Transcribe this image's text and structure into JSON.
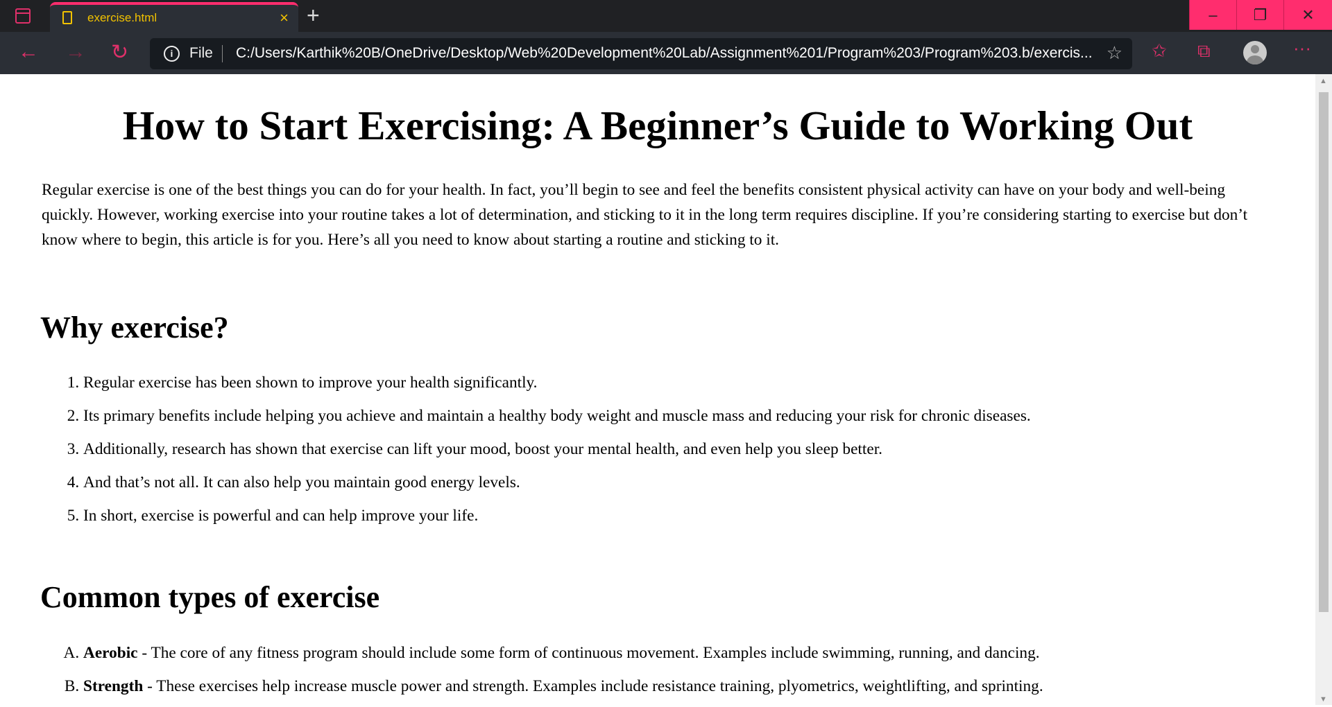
{
  "browser": {
    "tab_title": "exercise.html",
    "address_scheme": "File",
    "url": "C:/Users/Karthik%20B/OneDrive/Desktop/Web%20Development%20Lab/Assignment%201/Program%203/Program%203.b/exercis...",
    "accent": "#ff2d6e"
  },
  "page": {
    "title": "How to Start Exercising: A Beginner’s Guide to Working Out",
    "intro": "Regular exercise is one of the best things you can do for your health. In fact, you’ll begin to see and feel the benefits consistent physical activity can have on your body and well-being quickly. However, working exercise into your routine takes a lot of determination, and sticking to it in the long term requires discipline. If you’re considering starting to exercise but don’t know where to begin, this article is for you. Here’s all you need to know about starting a routine and sticking to it.",
    "why_heading": "Why exercise?",
    "why_items": [
      "Regular exercise has been shown to improve your health significantly.",
      "Its primary benefits include helping you achieve and maintain a healthy body weight and muscle mass and reducing your risk for chronic diseases.",
      "Additionally, research has shown that exercise can lift your mood, boost your mental health, and even help you sleep better.",
      "And that’s not all. It can also help you maintain good energy levels.",
      "In short, exercise is powerful and can help improve your life."
    ],
    "types_heading": "Common types of exercise",
    "types": [
      {
        "name": "Aerobic",
        "desc": " - The core of any fitness program should include some form of continuous movement. Examples include swimming, running, and dancing."
      },
      {
        "name": "Strength",
        "desc": " - These exercises help increase muscle power and strength. Examples include resistance training, plyometrics, weightlifting, and sprinting."
      }
    ]
  }
}
